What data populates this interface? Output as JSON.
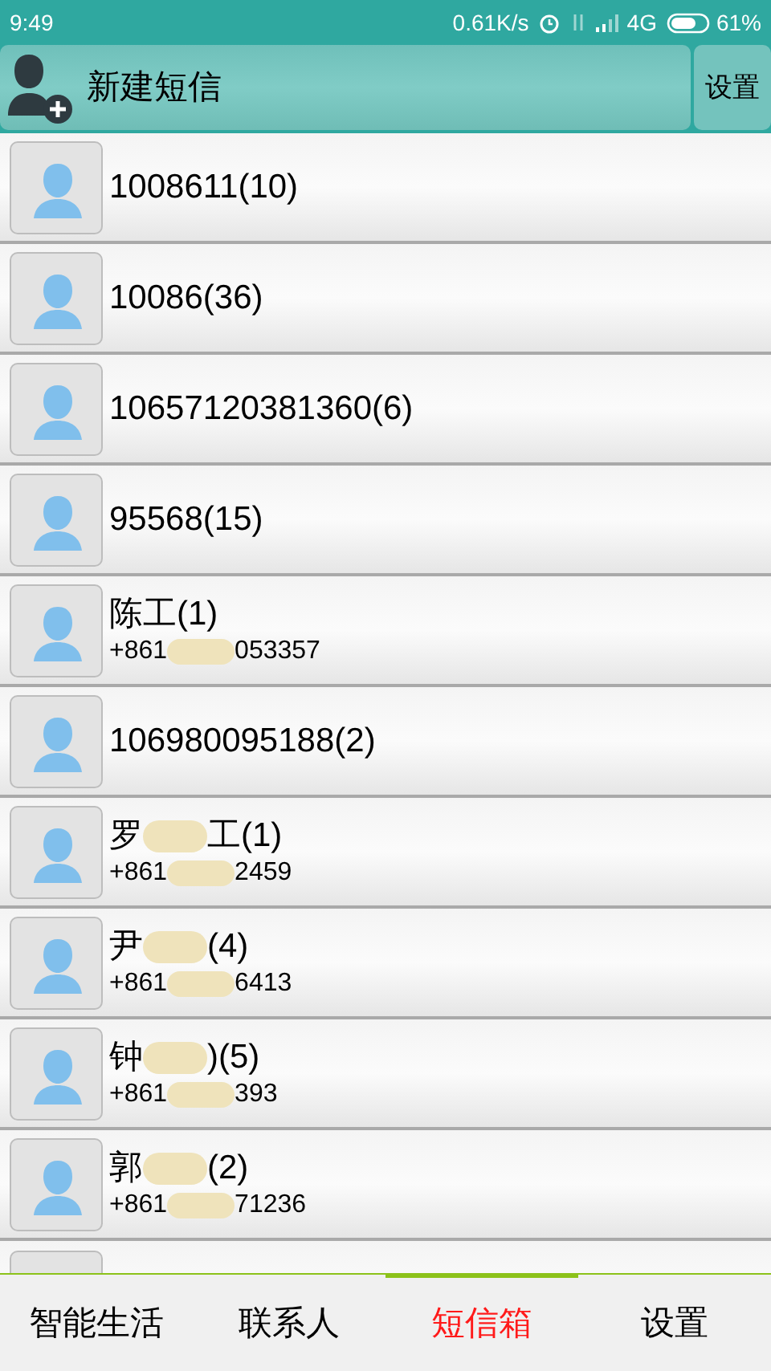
{
  "status_bar": {
    "time": "9:49",
    "speed": "0.61K/s",
    "network": "4G",
    "battery": "61%"
  },
  "header": {
    "title": "新建短信",
    "settings": "设置"
  },
  "threads": [
    {
      "kind": "full",
      "title": "1008611(10)"
    },
    {
      "kind": "full",
      "title": "10086(36)"
    },
    {
      "kind": "full",
      "title": "10657120381360(6)"
    },
    {
      "kind": "full",
      "title": "95568(15)"
    },
    {
      "kind": "full",
      "title": "陈工(1)",
      "number": "+861",
      "number_end": "053357",
      "redacted": true
    },
    {
      "kind": "full",
      "title": "106980095188(2)"
    },
    {
      "kind": "full",
      "title": "罗",
      "title_end": "工(1)",
      "number": "+861",
      "number_end": "2459",
      "redacted": true
    },
    {
      "kind": "full",
      "title": "尹",
      "title_end": "(4)",
      "number": "+861",
      "number_end": "6413",
      "redacted": true
    },
    {
      "kind": "full",
      "title": "钟",
      "title_end": ")(5)",
      "number": "+861",
      "number_end": "393",
      "redacted": true
    },
    {
      "kind": "full",
      "title": "郭",
      "title_end": "(2)",
      "number": "+861",
      "number_end": "71236",
      "redacted": true
    },
    {
      "kind": "cut_off"
    }
  ],
  "tabs": [
    {
      "label": "智能生活",
      "selected": false
    },
    {
      "label": "联系人",
      "selected": false
    },
    {
      "label": "短信箱",
      "selected": true
    },
    {
      "label": "设置",
      "selected": false
    }
  ]
}
